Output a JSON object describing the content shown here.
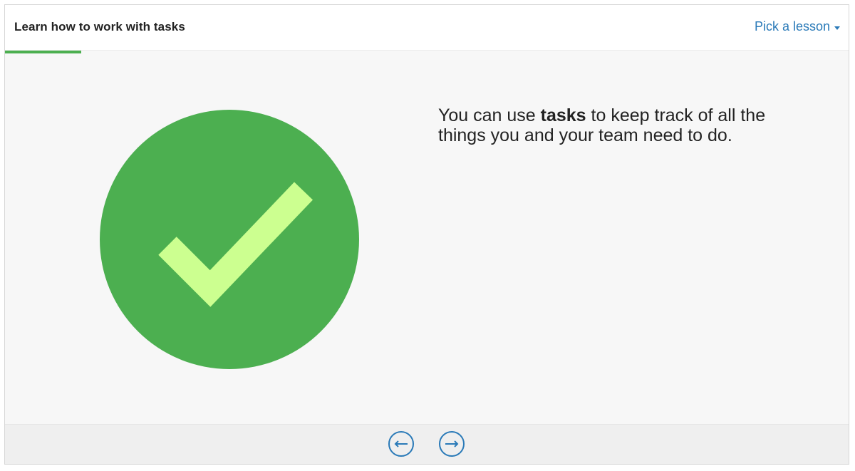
{
  "header": {
    "title": "Learn how to work with tasks",
    "lesson_picker_label": "Pick a lesson",
    "lesson_picker_icon": "caret-down-icon"
  },
  "progress": {
    "fraction": 0.09,
    "color": "#4caf50"
  },
  "slide": {
    "illustration_icon": "checkmark-circle-icon",
    "circle_color": "#4caf50",
    "check_color": "#ccff90",
    "text_before": "You can use ",
    "text_bold": "tasks",
    "text_after": " to keep track of all the things you and your team need to do."
  },
  "footer": {
    "prev_icon": "arrow-left-icon",
    "next_icon": "arrow-right-icon",
    "accent_color": "#2a7ab8"
  }
}
